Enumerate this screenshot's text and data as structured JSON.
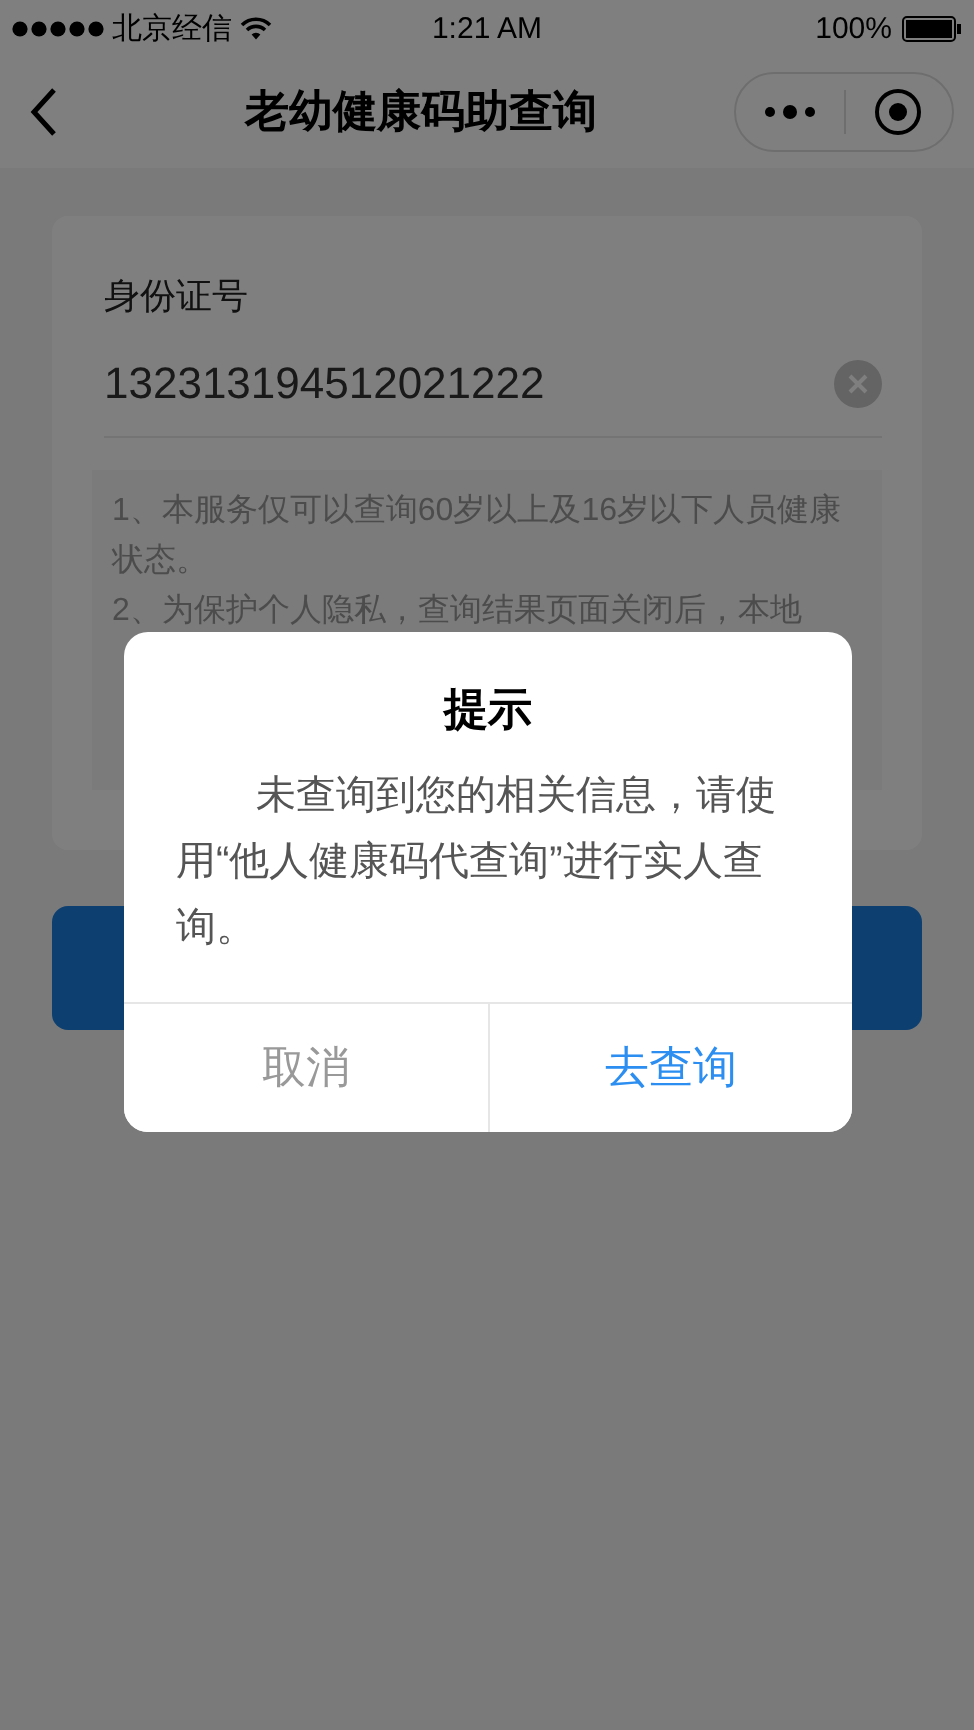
{
  "status_bar": {
    "carrier": "北京经信",
    "time": "1:21 AM",
    "battery": "100%"
  },
  "nav_bar": {
    "title": "老幼健康码助查询"
  },
  "form": {
    "label": "身份证号",
    "value": "132313194512021222",
    "notes": [
      "1、本服务仅可以查询60岁以上及16岁以下人员健康状态。",
      "2、为保护个人隐私，查询结果页面关闭后，本地"
    ]
  },
  "dialog": {
    "title": "提示",
    "message": "未查询到您的相关信息，请使用“他人健康码代查询”进行实人查询。",
    "buttons": [
      {
        "label": "取消",
        "kind": "cancel"
      },
      {
        "label": "去查询",
        "kind": "confirm"
      }
    ]
  }
}
